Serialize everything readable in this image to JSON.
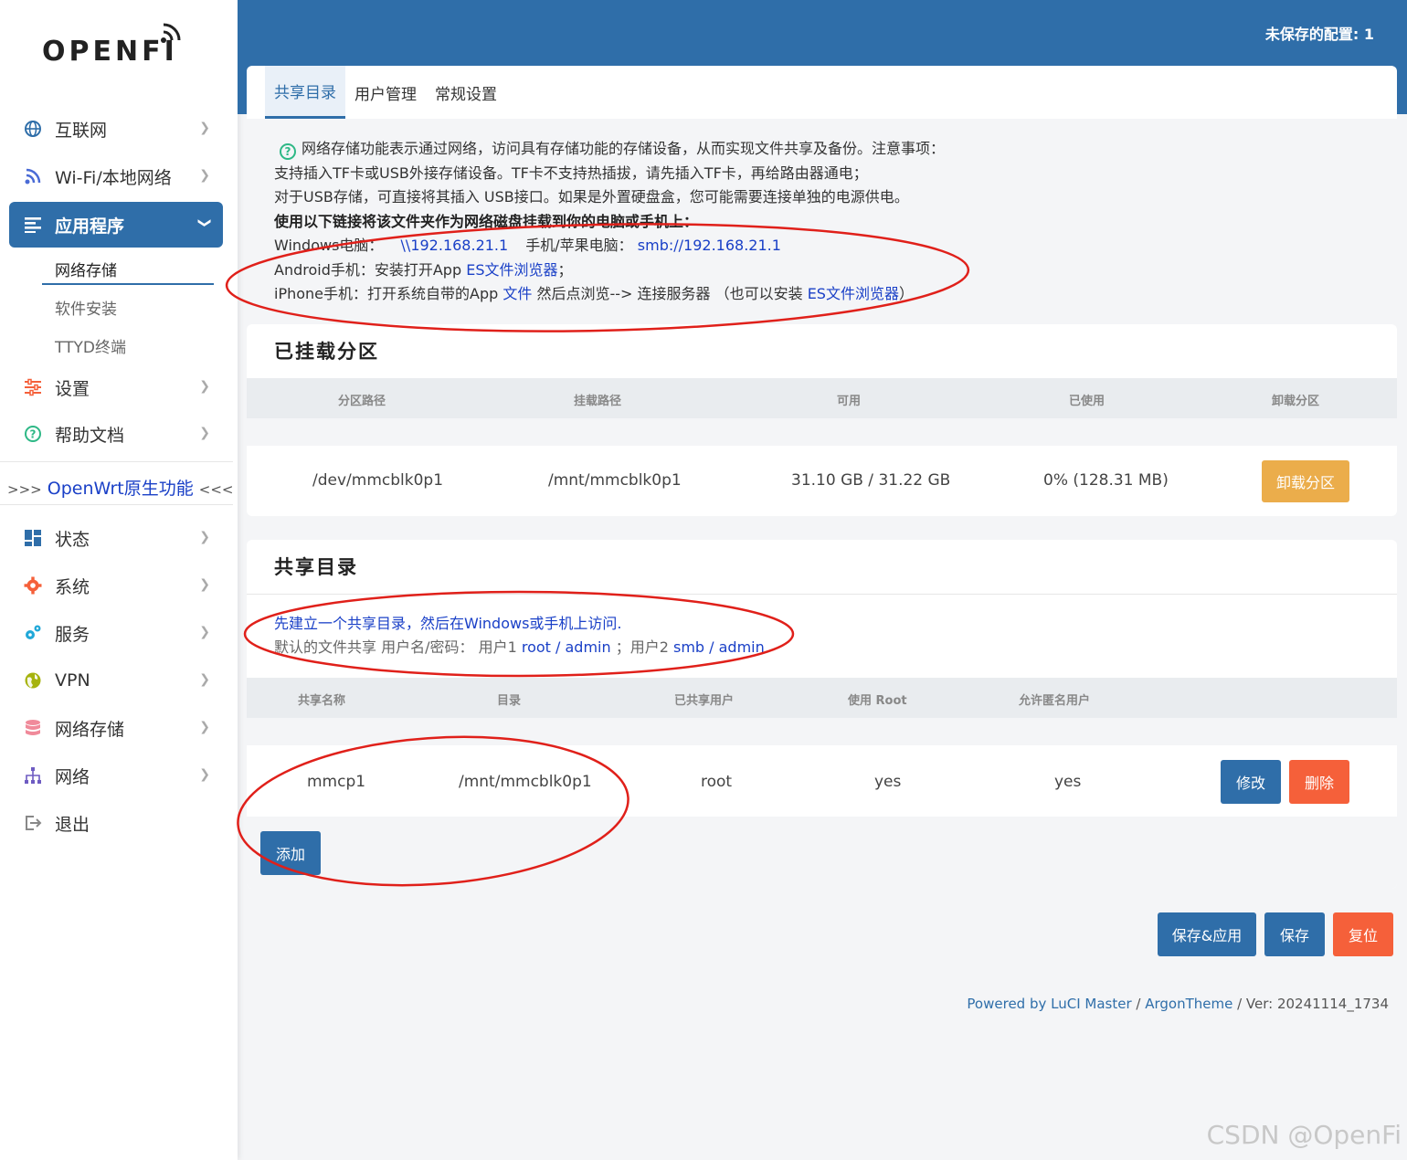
{
  "brand": {
    "logo_text": "OPENFI"
  },
  "header": {
    "unsaved_text": "未保存的配置: 1"
  },
  "sidebar": {
    "items_top": [
      {
        "label": "互联网",
        "icon": "globe-icon"
      },
      {
        "label": "Wi-Fi/本地网络",
        "icon": "rss-icon"
      },
      {
        "label": "应用程序",
        "icon": "list-icon"
      }
    ],
    "sub_items": [
      "网络存储",
      "软件安装",
      "TTYD终端"
    ],
    "items_mid": [
      {
        "label": "设置",
        "icon": "sliders-icon"
      },
      {
        "label": "帮助文档",
        "icon": "help-icon"
      }
    ],
    "native_prefix": ">>>",
    "native_label": "OpenWrt原生功能",
    "native_suffix": "<<<",
    "items_bottom": [
      {
        "label": "状态",
        "icon": "dashboard-icon"
      },
      {
        "label": "系统",
        "icon": "gear-icon"
      },
      {
        "label": "服务",
        "icon": "cogs-icon"
      },
      {
        "label": "VPN",
        "icon": "vpn-icon"
      },
      {
        "label": "网络存储",
        "icon": "database-icon"
      },
      {
        "label": "网络",
        "icon": "network-icon"
      },
      {
        "label": "退出",
        "icon": "logout-icon"
      }
    ]
  },
  "tabs": [
    "共享目录",
    "用户管理",
    "常规设置"
  ],
  "description": {
    "line1": "网络存储功能表示通过网络，访问具有存储功能的存储设备，从而实现文件共享及备份。注意事项：",
    "line2": "支持插入TF卡或USB外接存储设备。TF卡不支持热插拔，请先插入TF卡，再给路由器通电；",
    "line3": "对于USB存储，可直接将其插入 USB接口。如果是外置硬盘盒，您可能需要连接单独的电源供电。",
    "line4": "使用以下链接将该文件夹作为网络磁盘挂载到你的电脑或手机上：",
    "win_label": "Windows电脑：",
    "win_link": "\\\\192.168.21.1",
    "mac_label": "手机/苹果电脑：",
    "mac_link": "smb://192.168.21.1",
    "android_label": "Android手机：安装打开App ",
    "android_link": "ES文件浏览器",
    "android_end": "；",
    "iphone_label": "iPhone手机：打开系统自带的App ",
    "iphone_link1": "文件",
    "iphone_mid": " 然后点浏览--> 连接服务器 （也可以安装 ",
    "iphone_link2": "ES文件浏览器",
    "iphone_end": "）"
  },
  "mounted": {
    "title": "已挂载分区",
    "headers": [
      "分区路径",
      "挂载路径",
      "可用",
      "已使用",
      "卸载分区"
    ],
    "row": [
      "/dev/mmcblk0p1",
      "/mnt/mmcblk0p1",
      "31.10 GB / 31.22 GB",
      "0% (128.31 MB)"
    ],
    "unmount_label": "卸载分区"
  },
  "shares": {
    "title": "共享目录",
    "note1": "先建立一个共享目录，然后在Windows或手机上访问.",
    "note2_pre": "默认的文件共享 用户名/密码： 用户1 ",
    "note2_u1": "root / admin",
    "note2_mid": " ；用户2 ",
    "note2_u2": "smb / admin",
    "headers": [
      "共享名称",
      "目录",
      "已共享用户",
      "使用 Root",
      "允许匿名用户"
    ],
    "row": [
      "mmcp1",
      "/mnt/mmcblk0p1",
      "root",
      "yes",
      "yes"
    ],
    "edit_label": "修改",
    "delete_label": "删除",
    "add_label": "添加"
  },
  "actions": {
    "save_apply": "保存&应用",
    "save": "保存",
    "reset": "复位"
  },
  "footer": {
    "powered": "Powered by LuCI Master",
    "sep1": " / ",
    "theme": "ArgonTheme",
    "ver": " / Ver: 20241114_1734"
  },
  "watermark": "CSDN @OpenFi",
  "colors": {
    "primary": "#2f6ea9",
    "warning": "#ebad4b",
    "danger": "#f5603a",
    "annotation": "#e0201a"
  }
}
